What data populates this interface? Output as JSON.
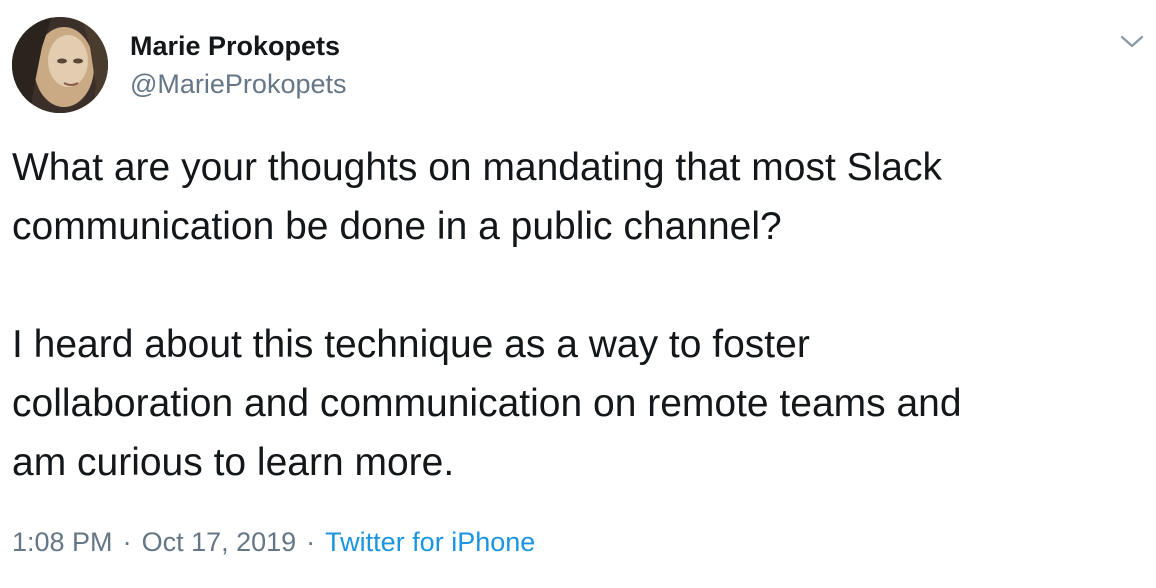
{
  "author": {
    "name": "Marie Prokopets",
    "handle": "@MarieProkopets"
  },
  "tweet": {
    "lines": [
      "What are your thoughts on mandating that most Slack",
      "communication be done in a public channel?",
      "",
      "I heard about this technique as a way to foster",
      "collaboration and communication on remote teams and",
      "am curious to learn more."
    ]
  },
  "meta": {
    "time": "1:08 PM",
    "separator": "·",
    "date": "Oct 17, 2019",
    "source": "Twitter for iPhone"
  },
  "colors": {
    "text": "#14171a",
    "secondary": "#657786",
    "link": "#1b95e0"
  },
  "icons": {
    "more": "chevron-down-icon",
    "avatar": "avatar"
  }
}
